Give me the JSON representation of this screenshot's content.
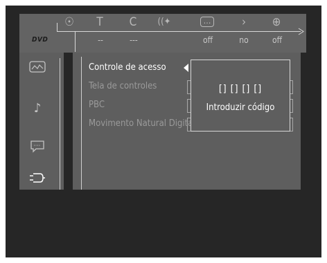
{
  "top_bar": {
    "logo": "DVD",
    "icons": [
      {
        "name": "angle-icon",
        "glyph": "☉"
      },
      {
        "name": "title-icon",
        "glyph": "T"
      },
      {
        "name": "chapter-icon",
        "glyph": "C"
      },
      {
        "name": "audio-icon",
        "glyph": "((✦"
      },
      {
        "name": "subtitle-icon",
        "glyph": "…"
      },
      {
        "name": "repeat-icon",
        "glyph": "›"
      },
      {
        "name": "zoom-icon",
        "glyph": "⊕"
      }
    ],
    "values": [
      "--",
      "---",
      "off",
      "no",
      "off"
    ]
  },
  "sidebar": {
    "items": [
      {
        "name": "picture-icon",
        "glyph": "⌇"
      },
      {
        "name": "music-note-icon",
        "glyph": "♪"
      },
      {
        "name": "speech-bubble-icon",
        "glyph": "▢"
      },
      {
        "name": "settings-plug-icon",
        "glyph": "⮌"
      }
    ]
  },
  "menu": {
    "items": [
      {
        "label": "Controle de acesso",
        "state": "active"
      },
      {
        "label": "Tela de controles",
        "state": "inactive"
      },
      {
        "label": "PBC",
        "state": "inactive"
      },
      {
        "label": "Movimento Natural Digital",
        "state": "inactive"
      }
    ]
  },
  "popup": {
    "code": "[] [] [] []",
    "prompt": "Introduzir código"
  },
  "colors": {
    "background": "#262626",
    "panel": "#5e5e5e",
    "active_text": "#ffffff",
    "inactive_text": "#9a9a9a"
  }
}
